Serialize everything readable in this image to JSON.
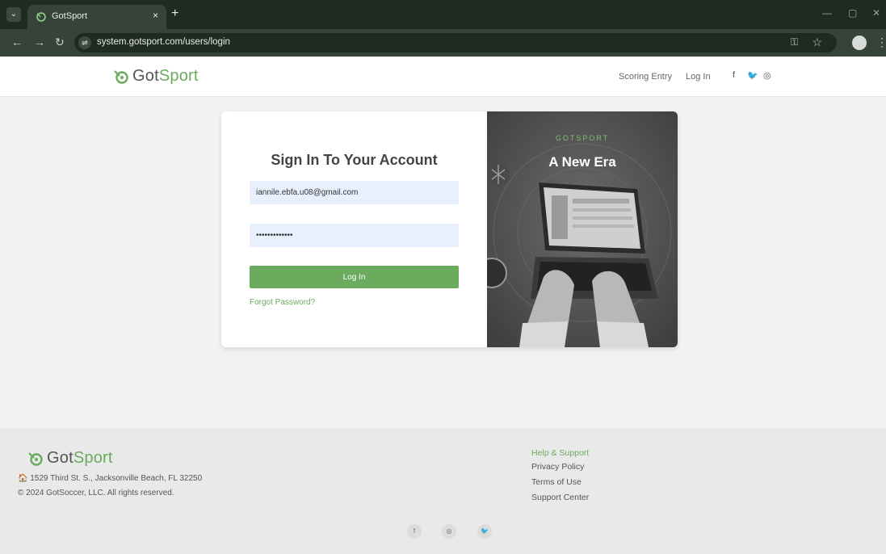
{
  "browser": {
    "tab_title": "GotSport",
    "tab_close": "×",
    "new_tab": "+",
    "tab_list": "⌄",
    "url": "system.gotsport.com/users/login",
    "back": "←",
    "forward": "→",
    "reload": "↻",
    "site_info": "⇌",
    "key": "⚿",
    "star": "☆",
    "menu": "⋮",
    "minimize": "—",
    "maximize": "▢",
    "close": "✕"
  },
  "logo": {
    "part1": "Got",
    "part2": "Sport"
  },
  "header": {
    "links": [
      "Scoring Entry",
      "Log In"
    ],
    "social": [
      "f",
      "🐦",
      "◎"
    ]
  },
  "login": {
    "heading": "Sign In To Your Account",
    "email_value": "iannile.ebfa.u08@gmail.com",
    "password_value": "•••••••••••••",
    "button_label": "Log In",
    "forgot_label": "Forgot Password?"
  },
  "promo": {
    "kicker": "GOTSPORT",
    "title": "A New Era"
  },
  "footer": {
    "address": "🏠 1529 Third St. S., Jacksonville Beach, FL 32250",
    "copyright": "© 2024 GotSoccer, LLC. All rights reserved.",
    "links": [
      "Help & Support",
      "Privacy Policy",
      "Terms of Use",
      "Support Center"
    ],
    "social": [
      "f",
      "◎",
      "🐦"
    ]
  },
  "colors": {
    "brand_green": "#6aab5e",
    "chrome_dark": "#1f2a22",
    "chrome_mid": "#35433a"
  }
}
